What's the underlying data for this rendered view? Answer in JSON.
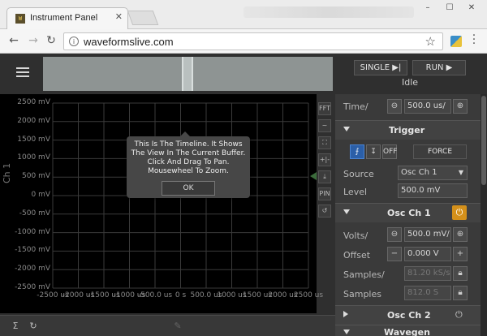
{
  "browser": {
    "tab_title": "Instrument Panel",
    "tab_favicon_text": "W",
    "url": "waveformslive.com"
  },
  "app": {
    "single_label": "SINGLE",
    "run_label": "RUN",
    "status": "Idle"
  },
  "plot": {
    "y_axis_label": "Ch 1",
    "y_ticks": [
      "2500 mV",
      "2000 mV",
      "1500 mV",
      "1000 mV",
      "500 mV",
      "0 mV",
      "-500 mV",
      "-1000 mV",
      "-1500 mV",
      "-2000 mV",
      "-2500 mV"
    ],
    "x_ticks": [
      "-2500 us",
      "-2000 us",
      "-1500 us",
      "-1000 us",
      "-500.0 us",
      "0 s",
      "500.0 us",
      "1000 us",
      "1500 us",
      "2000 us",
      "2500 us"
    ],
    "side_tools": [
      "FFT",
      "~",
      "⛶",
      "+|-",
      "⤓",
      "PIN",
      "↺"
    ]
  },
  "tooltip": {
    "text": "This Is The Timeline. It Shows The View In The Current Buffer. Click And Drag To Pan. Mousewheel To Zoom.",
    "ok_label": "OK"
  },
  "panel": {
    "time_label": "Time/",
    "time_value": "500.0 us/",
    "trigger": {
      "title": "Trigger",
      "off_label": "OFF",
      "force_label": "FORCE",
      "source_label": "Source",
      "source_value": "Osc Ch 1",
      "level_label": "Level",
      "level_value": "500.0 mV"
    },
    "osc1": {
      "title": "Osc Ch 1",
      "volts_label": "Volts/",
      "volts_value": "500.0 mV/",
      "offset_label": "Offset",
      "offset_value": "0.000 V",
      "samples_rate_label": "Samples/",
      "samples_rate_value": "81.20 kS/s",
      "samples_label": "Samples",
      "samples_value": "812.0 S"
    },
    "osc2": {
      "title": "Osc Ch 2"
    },
    "next_section_partial": "Wavegen"
  },
  "colors": {
    "power_on": "#d4901a",
    "fab": "#e8202a",
    "trigger_active": "#2b5fa8"
  }
}
